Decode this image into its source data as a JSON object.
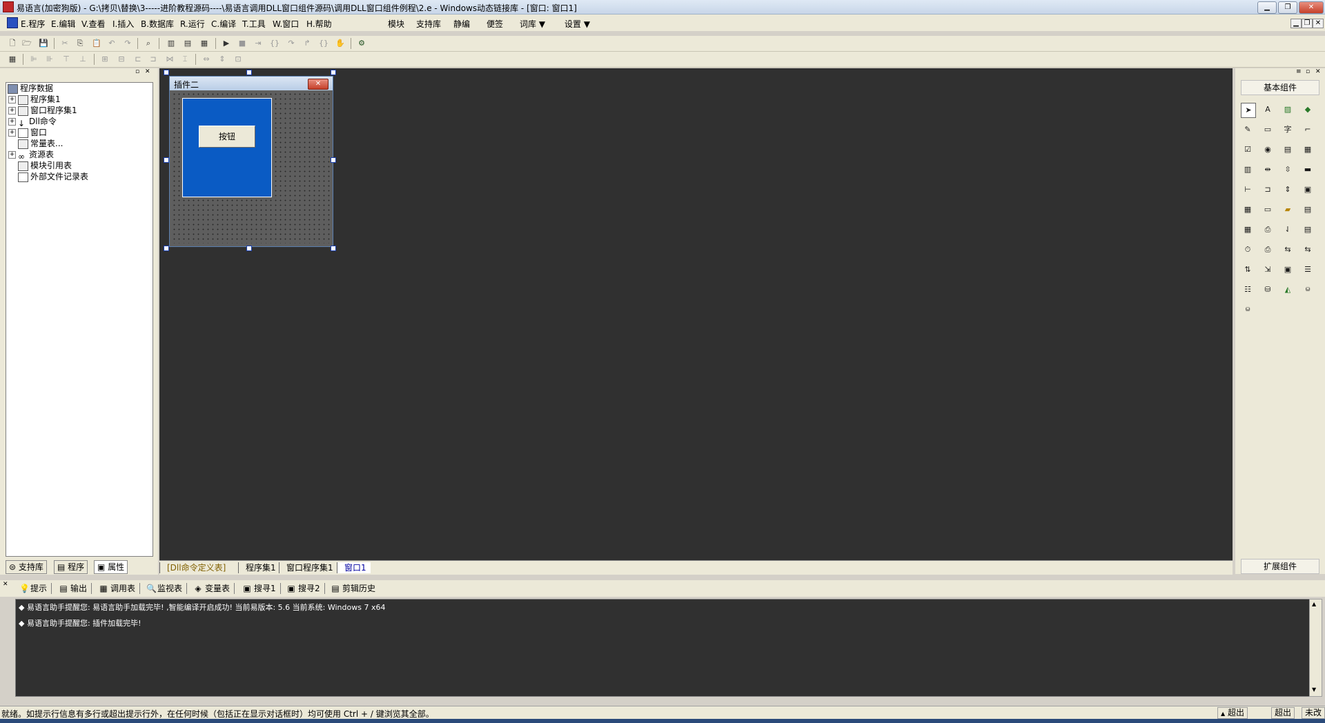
{
  "window": {
    "title": "易语言(加密狗版) - G:\\拷贝\\替换\\3-----进阶教程源码----\\易语言调用DLL窗口组件源码\\调用DLL窗口组件例程\\2.e - Windows动态链接库 - [窗口: 窗口1]",
    "min_label": "▁",
    "max_label": "❐",
    "close_label": "✕"
  },
  "menubar": {
    "items": [
      {
        "label": "E.程序"
      },
      {
        "label": "E.编辑"
      },
      {
        "label": "V.查看"
      },
      {
        "label": "I.插入"
      },
      {
        "label": "B.数据库"
      },
      {
        "label": "R.运行"
      },
      {
        "label": "C.编译"
      },
      {
        "label": "T.工具"
      },
      {
        "label": "W.窗口"
      },
      {
        "label": "H.帮助"
      }
    ],
    "extra": [
      {
        "label": "模块"
      },
      {
        "label": "支持库"
      },
      {
        "label": "静编"
      },
      {
        "label": "便签"
      },
      {
        "label": "词库 ▼"
      },
      {
        "label": "设置 ▼"
      }
    ]
  },
  "tree": {
    "root": "程序数据",
    "items": [
      {
        "label": "程序集1",
        "expand": "+"
      },
      {
        "label": "窗口程序集1",
        "expand": "+"
      },
      {
        "label": "Dll命令",
        "expand": "+"
      },
      {
        "label": "窗口",
        "expand": "+"
      },
      {
        "label": "常量表...",
        "expand": ""
      },
      {
        "label": "资源表",
        "expand": "+"
      },
      {
        "label": "模块引用表",
        "expand": ""
      },
      {
        "label": "外部文件记录表",
        "expand": ""
      }
    ]
  },
  "left_tabs": [
    {
      "label": "支持库"
    },
    {
      "label": "程序"
    },
    {
      "label": "属性"
    }
  ],
  "form": {
    "title": "插件二",
    "button_label": "按钮"
  },
  "designer_tabs": [
    {
      "label": "[Dll命令定义表]"
    },
    {
      "label": "程序集1"
    },
    {
      "label": "窗口程序集1"
    },
    {
      "label": "窗口1"
    }
  ],
  "components": {
    "basic_label": "基本组件",
    "extend_label": "扩展组件"
  },
  "output_tabs": [
    {
      "label": "提示",
      "icon": "💡"
    },
    {
      "label": "输出",
      "icon": "▤"
    },
    {
      "label": "调用表",
      "icon": "▦"
    },
    {
      "label": "监视表",
      "icon": "🔍"
    },
    {
      "label": "变量表",
      "icon": "◈"
    },
    {
      "label": "搜寻1",
      "icon": "▣"
    },
    {
      "label": "搜寻2",
      "icon": "▣"
    },
    {
      "label": "剪辑历史",
      "icon": "▤"
    }
  ],
  "output": {
    "lines": [
      "◆ 易语言助手提醒您: 易语言助手加载完毕! ,智能编译开启成功! 当前易版本: 5.6 当前系统: Windows 7 x64",
      "◆ 易语言助手提醒您: 插件加载完毕!"
    ]
  },
  "status": {
    "text": "就绪。如提示行信息有多行或超出提示行外，在任何时候（包括正在显示对话框时）均可使用 Ctrl + / 键浏览其全部。",
    "panel1": "超出",
    "panel2": "超出",
    "panel3": "未改"
  }
}
